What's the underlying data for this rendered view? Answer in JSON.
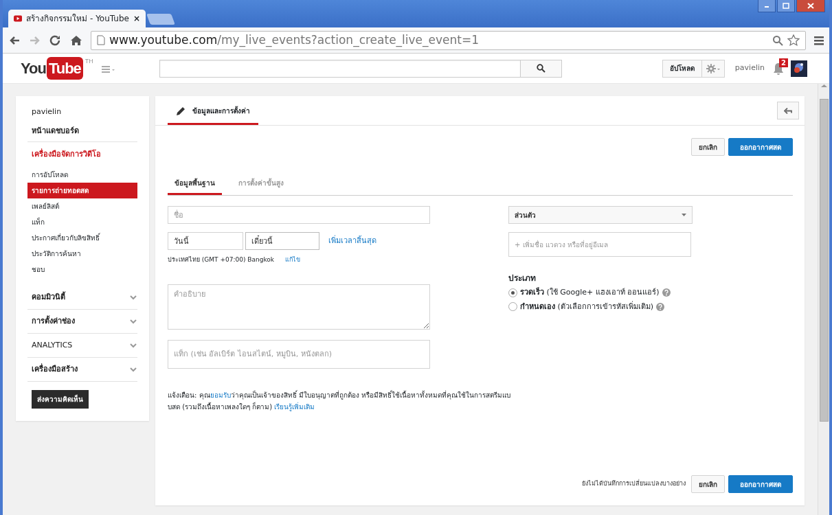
{
  "browser": {
    "tab_title": "สร้างกิจกรรมใหม่ - YouTube",
    "tab_close": "×",
    "url_host": "www.youtube.com",
    "url_path": "/my_live_events?action_create_live_event=1"
  },
  "header": {
    "logo_you": "You",
    "logo_tube": "Tube",
    "region": "TH",
    "upload": "อัปโหลด",
    "username": "pavielin",
    "notifications": "2"
  },
  "sidebar": {
    "items": [
      {
        "kind": "user",
        "label": "pavielin"
      },
      {
        "kind": "link",
        "label": "หน้าแดชบอร์ด"
      },
      {
        "kind": "section",
        "label": "เครื่องมือจัดการวิดีโอ",
        "children": [
          {
            "label": "การอัปโหลด",
            "selected": false
          },
          {
            "label": "รายการถ่ายทอดสด",
            "selected": true
          },
          {
            "label": "เพลย์ลิสต์",
            "selected": false
          },
          {
            "label": "แท็ก",
            "selected": false
          },
          {
            "label": "ประกาศเกี่ยวกับลิขสิทธิ์",
            "selected": false
          },
          {
            "label": "ประวัติการค้นหา",
            "selected": false
          },
          {
            "label": "ชอบ",
            "selected": false
          }
        ]
      },
      {
        "kind": "group",
        "label": "คอมมิวนิตี้",
        "expanded": false
      },
      {
        "kind": "group",
        "label": "การตั้งค่าช่อง",
        "expanded": false
      },
      {
        "kind": "group",
        "label": "ANALYTICS",
        "expanded": false
      },
      {
        "kind": "group",
        "label": "เครื่องมือสร้าง",
        "expanded": false
      }
    ],
    "feedback": "ส่งความคิดเห็น"
  },
  "main": {
    "title_tab": "ข้อมูลและการตั้งค่า",
    "cancel": "ยกเลิก",
    "go_live": "ออกอากาศสด",
    "tabs": [
      {
        "label": "ข้อมูลพื้นฐาน",
        "selected": true
      },
      {
        "label": "การตั้งค่าขั้นสูง",
        "selected": false
      }
    ],
    "title_field": {
      "placeholder": "ชื่อ"
    },
    "date": "วันนี้",
    "time": "เดี๋ยวนี้",
    "add_end_time": "เพิ่มเวลาสิ้นสุด",
    "timezone": "ประเทศไทย (GMT +07:00) Bangkok",
    "edit": "แก้ไข",
    "description": {
      "placeholder": "คำอธิบาย"
    },
    "tags": {
      "placeholder": "แท็ก (เช่น อัลเบิร์ต ไอนสไตน์, หมูบิน, หนังตลก)"
    },
    "privacy": "ส่วนตัว",
    "share": {
      "placeholder": "+ เพิ่มชื่อ แวดวง หรือที่อยู่อีเมล"
    },
    "type_heading": "ประเภท",
    "types": [
      {
        "label": "**รวดเร็ว** (ใช้ Google+ แฮงเอาท์ ออนแอร์)",
        "selected": true
      },
      {
        "label": "**กำหนดเอง** (ตัวเลือกการเข้ารหัสเพิ่มเติม)",
        "selected": false
      }
    ],
    "warning": {
      "before": "แจ้งเตือน: คุณ",
      "link": "ยอมรับ",
      "after": "ว่าคุณเป็นเจ้าของสิทธิ์ มีใบอนุญาตที่ถูกต้อง หรือมีสิทธิ์ใช้เนื้อหาทั้งหมดที่คุณใช้ในการสตรีมแบบสด (รวมถึงเนื้อหาเพลงใดๆ ก็ตาม) ",
      "learn_more": "เรียนรู้เพิ่มเติม"
    },
    "unsaved": "ยังไม่ได้บันทึกการเปลี่ยนแปลงบางอย่าง",
    "footer_cancel": "ยกเลิก",
    "footer_go_live": "ออกอากาศสด"
  }
}
